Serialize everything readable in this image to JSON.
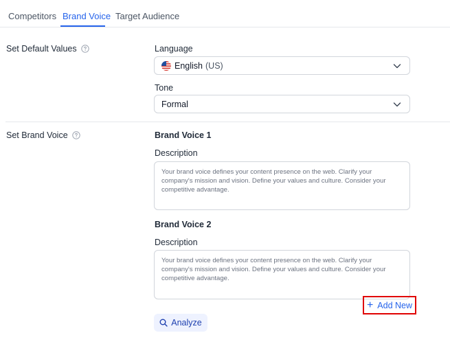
{
  "tabs": [
    {
      "label": "Competitors"
    },
    {
      "label": "Brand Voice"
    },
    {
      "label": "Target Audience"
    }
  ],
  "default_values": {
    "section_label": "Set Default Values",
    "language_label": "Language",
    "language_value": "English",
    "language_region": "(US)",
    "tone_label": "Tone",
    "tone_value": "Formal"
  },
  "brand_voice": {
    "section_label": "Set Brand Voice",
    "voices": [
      {
        "title": "Brand Voice 1",
        "description_label": "Description",
        "placeholder": "Your brand voice defines your content presence on the web. Clarify your company's mission and vision. Define your values and culture. Consider your competitive advantage."
      },
      {
        "title": "Brand Voice 2",
        "description_label": "Description",
        "placeholder": "Your brand voice defines your content presence on the web. Clarify your company's mission and vision. Define your values and culture. Consider your competitive advantage."
      }
    ],
    "add_new_label": "Add New",
    "analyze_label": "Analyze"
  },
  "icons": {
    "help": "help-circle-icon",
    "chevron": "chevron-down-icon",
    "flag": "us-flag-icon",
    "plus": "plus-icon",
    "search": "search-icon"
  },
  "colors": {
    "accent": "#2563eb",
    "highlight_border": "#e00000",
    "analyze_bg": "#eef2ff"
  }
}
